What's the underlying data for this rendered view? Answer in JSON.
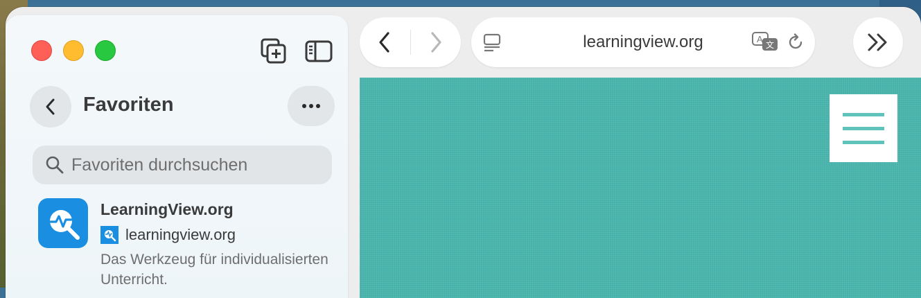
{
  "sidebar": {
    "title": "Favoriten",
    "search_placeholder": "Favoriten durchsuchen",
    "favorites": [
      {
        "title": "LearningView.org",
        "domain": "learningview.org",
        "description": "Das Werkzeug für individualisierten Unterricht."
      }
    ]
  },
  "toolbar": {
    "url": "learningview.org"
  },
  "colors": {
    "traffic_red": "#fe5f57",
    "traffic_yellow": "#febc2e",
    "traffic_green": "#28c840",
    "page_teal": "#45b1a9",
    "hamburger_lines": "#5fc3bb",
    "brand_blue": "#1a8ee0"
  },
  "icons": {
    "new_tab": "new-tab-icon",
    "sidebar_toggle": "sidebar-toggle-icon",
    "back": "chevron-left-icon",
    "more": "ellipsis-icon",
    "search": "search-icon",
    "reader": "reader-mode-icon",
    "translate": "translate-icon",
    "reload": "reload-icon",
    "toolbar_more": "double-chevron-right-icon",
    "menu": "hamburger-menu-icon"
  }
}
